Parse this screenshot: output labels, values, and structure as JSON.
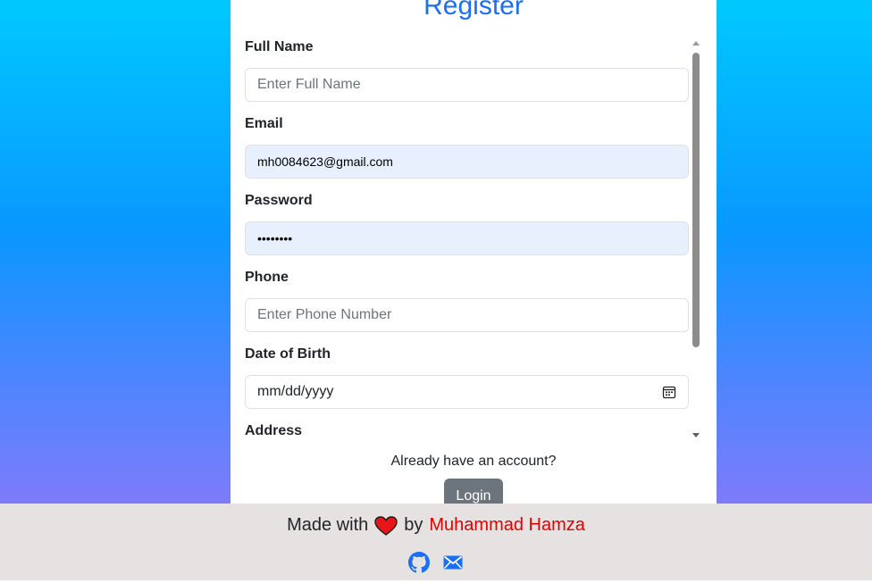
{
  "form": {
    "title": "Register",
    "fields": [
      {
        "label": "Full Name",
        "placeholder": "Enter Full Name",
        "value": ""
      },
      {
        "label": "Email",
        "placeholder": "",
        "value": "mh0084623@gmail.com"
      },
      {
        "label": "Password",
        "placeholder": "",
        "value": "••••••••"
      },
      {
        "label": "Phone",
        "placeholder": "Enter Phone Number",
        "value": ""
      },
      {
        "label": "Date of Birth",
        "placeholder": "mm/dd/yyyy",
        "value": ""
      },
      {
        "label": "Address",
        "placeholder": "",
        "value": ""
      }
    ],
    "already_text": "Already have an account?",
    "login_label": "Login"
  },
  "footer": {
    "made_with": "Made with",
    "by": "by",
    "author": "Muhammad Hamza",
    "icons": [
      "github-icon",
      "mail-icon"
    ]
  },
  "colors": {
    "title": "#1a6ff5",
    "author": "#e60000",
    "login_button": "#6c757d",
    "autofill_bg": "#e8f0fe"
  }
}
